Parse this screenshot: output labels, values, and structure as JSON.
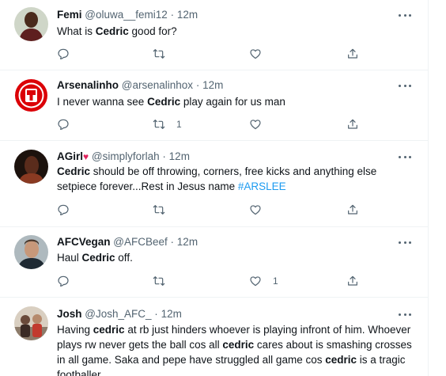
{
  "tweets": [
    {
      "name": "Femi",
      "handle": "@oluwa__femi12",
      "time": "12m",
      "text": [
        "What is ",
        {
          "b": "Cedric"
        },
        " good for?"
      ],
      "reply_count": "",
      "retweet_count": "",
      "like_count": ""
    },
    {
      "name": "Arsenalinho",
      "handle": "@arsenalinhox",
      "time": "12m",
      "text": [
        "I never wanna see ",
        {
          "b": "Cedric"
        },
        " play again for us man"
      ],
      "reply_count": "",
      "retweet_count": "1",
      "like_count": ""
    },
    {
      "name": "AGirl",
      "name_emoji": "♥",
      "handle": "@simplyforlah",
      "time": "12m",
      "text": [
        {
          "b": "Cedric"
        },
        " should be off throwing, corners, free kicks and anything else setpiece forever...Rest in Jesus name ",
        {
          "tag": "#ARSLEE"
        }
      ],
      "reply_count": "",
      "retweet_count": "",
      "like_count": ""
    },
    {
      "name": "AFCVegan",
      "handle": "@AFCBeef",
      "time": "12m",
      "text": [
        "Haul ",
        {
          "b": "Cedric"
        },
        " off."
      ],
      "reply_count": "",
      "retweet_count": "",
      "like_count": "1"
    },
    {
      "name": "Josh",
      "handle": "@Josh_AFC_",
      "time": "12m",
      "text": [
        "Having ",
        {
          "b": "cedric"
        },
        " at rb just hinders whoever is playing infront of him. Whoever plays rw never gets the ball cos all ",
        {
          "b": "cedric"
        },
        " cares about is smashing crosses in all game. Saka and pepe have struggled all game cos ",
        {
          "b": "cedric"
        },
        " is a tragic footballer"
      ],
      "reply_count": "",
      "retweet_count": "",
      "like_count": ""
    }
  ],
  "separator": "·",
  "colors": {
    "text": "#0f1419",
    "secondary": "#536471",
    "link": "#1d9bf0",
    "heart": "#e0245e",
    "border": "#eff3f4"
  },
  "icons": {
    "reply": "reply-icon",
    "retweet": "retweet-icon",
    "like": "like-icon",
    "share": "share-icon",
    "more": "more-icon"
  }
}
